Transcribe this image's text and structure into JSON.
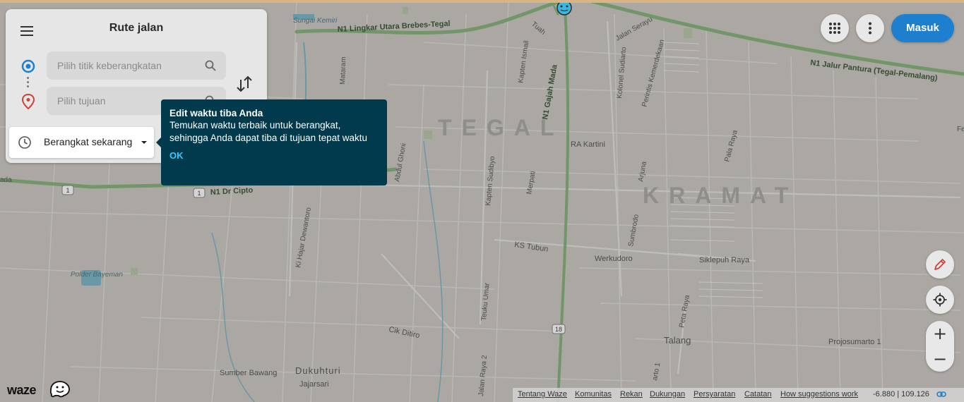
{
  "map": {
    "area_labels": [
      {
        "text": "TEGAL"
      },
      {
        "text": "KRAMAT"
      }
    ],
    "place_labels": [
      "Sungai Kemiri",
      "Polder Bayeman",
      "Dukuhturi",
      "Jajarsari",
      "Talang",
      "Projosumarto 1",
      "Sumber Bawang",
      "Cik Ditiro",
      "Werkudoro",
      "KS Tubun",
      "Siklepuh Raya",
      "RA Kartini"
    ],
    "road_labels": [
      "N1 Lingkar Utara Brebes-Tegal",
      "N1 Jalur Pantura (Tegal-Pemalang)",
      "N1 Dr Cipto",
      "N1 Gajah Mada",
      "Jalan Serayu",
      "Kolonel Sudiarto",
      "Perintis Kemerdekaan",
      "Kapten Ismail",
      "Kapten Sudibyo",
      "Mataram",
      "Ki Hajar Dewantoro",
      "Teuku Umar",
      "Jalan Raya 2",
      "Merpati",
      "Arjuna",
      "Sumbrodo",
      "Pala Raya",
      "Peta Raya",
      "Abdul Ghoni",
      "Tuah",
      "arto 1",
      "ada",
      "Fe"
    ],
    "shields": [
      "1",
      "1",
      "18"
    ]
  },
  "panel": {
    "title": "Rute jalan",
    "origin_placeholder": "Pilih titik keberangkatan",
    "destination_placeholder": "Pilih tujuan",
    "depart_label": "Berangkat sekarang"
  },
  "tooltip": {
    "title": "Edit waktu tiba Anda",
    "body": "Temukan waktu terbaik untuk berangkat, sehingga Anda dapat tiba di tujuan tepat waktu",
    "ok": "OK"
  },
  "header": {
    "login_label": "Masuk"
  },
  "zoom": {
    "in": "+",
    "out": "−"
  },
  "brand": {
    "name": "waze"
  },
  "footer": {
    "links": [
      "Tentang Waze",
      "Komunitas",
      "Rekan",
      "Dukungan",
      "Persyaratan",
      "Catatan",
      "How suggestions work"
    ],
    "coordinates": "-6.880 | 109.126"
  },
  "colors": {
    "map_bg": "#bdbab4",
    "major_road": "#79a36e",
    "tooltip_bg": "#003a4c",
    "tooltip_ok": "#33ccff",
    "login_bg": "#1f7fcf",
    "water": "#6fa6b8"
  }
}
